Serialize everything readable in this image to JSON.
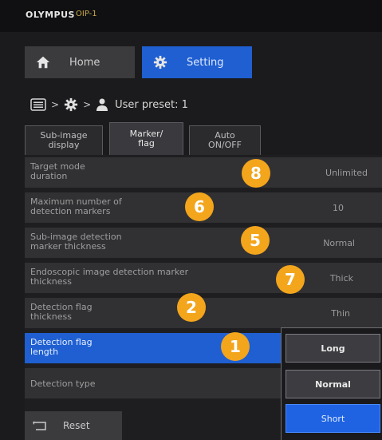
{
  "titlebar": {
    "brand": "OLYMPUS",
    "model": "OIP-1"
  },
  "top_tabs": [
    {
      "label": "Home",
      "icon": "home-icon"
    },
    {
      "label": "Setting",
      "icon": "gear-icon"
    }
  ],
  "breadcrumb": {
    "sep": ">",
    "preset": "User preset: 1"
  },
  "sub_tabs": [
    {
      "line1": "Sub-image",
      "line2": "display"
    },
    {
      "line1": "Marker/",
      "line2": "flag"
    },
    {
      "line1": "Auto",
      "line2": "ON/OFF"
    }
  ],
  "rows": [
    {
      "l1": "Target mode",
      "l2": "duration",
      "value": "Unlimited"
    },
    {
      "l1": "Maximum number of",
      "l2": "detection markers",
      "value": "10"
    },
    {
      "l1": "Sub-image detection",
      "l2": "marker thickness",
      "value": "Normal"
    },
    {
      "l1": "Endoscopic image detection marker",
      "l2": "thickness",
      "value": "Thick"
    },
    {
      "l1": "Detection flag",
      "l2": "thickness",
      "value": "Thin"
    },
    {
      "l1": "Detection flag",
      "l2": "length",
      "value": ""
    },
    {
      "l1": "Detection type",
      "l2": "",
      "value": ""
    }
  ],
  "callouts": [
    "8",
    "6",
    "5",
    "7",
    "2",
    "1"
  ],
  "dropdown": {
    "options": [
      "Long",
      "Normal",
      "Short"
    ],
    "selected": "Short"
  },
  "reset": {
    "label": "Reset"
  },
  "colors": {
    "accent": "#1f5fd1",
    "callout": "#f3a51c"
  }
}
